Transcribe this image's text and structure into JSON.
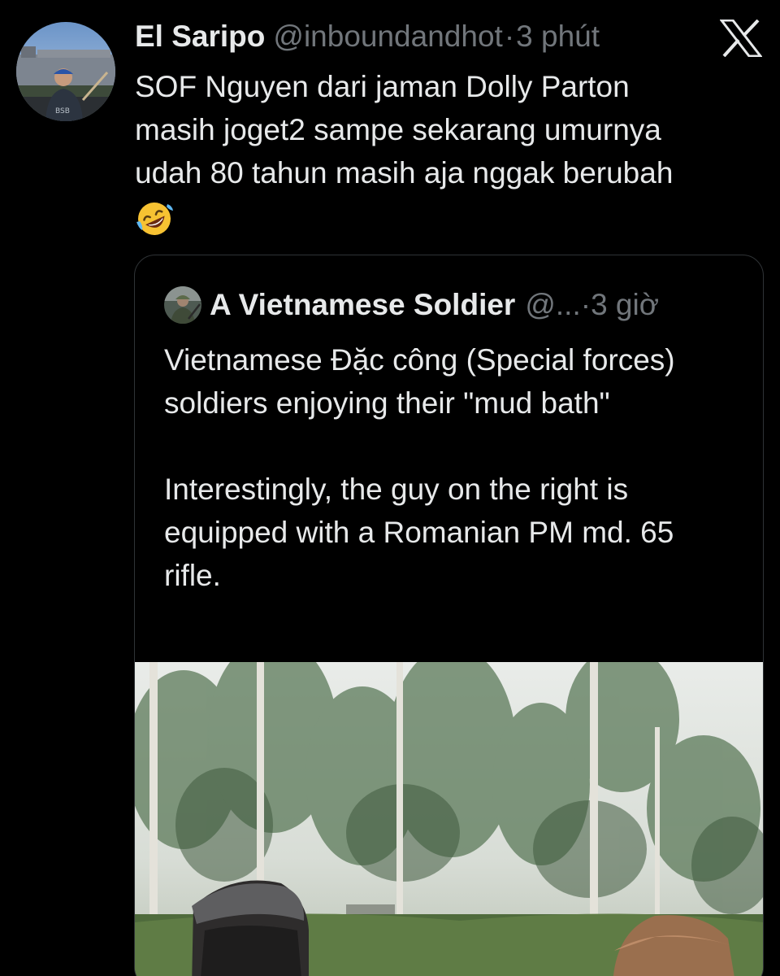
{
  "tweet": {
    "display_name": "El Saripo",
    "handle": "@inboundandhot",
    "separator": "·",
    "time": "3 phút",
    "text_lines": [
      "SOF Nguyen dari jaman Dolly Parton",
      "masih joget2 sampe sekarang umurnya",
      "udah 80 tahun masih aja nggak berubah"
    ],
    "emoji_icon": "rolling-on-floor-laughing-emoji"
  },
  "quote": {
    "display_name": "A Vietnamese Soldier",
    "handle": "@...",
    "separator": "·",
    "time": "3 giờ",
    "paragraph1": "Vietnamese Đặc công (Special forces) soldiers enjoying their \"mud bath\"",
    "paragraph2": "Interestingly, the guy on the right is equipped with a Romanian PM md. 65 rifle."
  },
  "icons": {
    "x_logo": "x-logo-icon",
    "avatar": "profile-avatar",
    "quote_avatar": "soldier-avatar"
  },
  "colors": {
    "background": "#000000",
    "primary_text": "#e7e9ea",
    "secondary_text": "#71767b",
    "card_border": "#2f3336"
  }
}
